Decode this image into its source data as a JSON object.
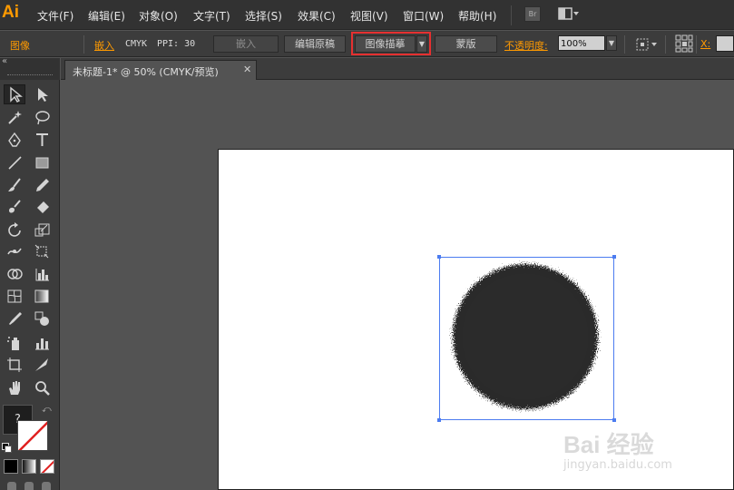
{
  "app": {
    "logo": "Ai"
  },
  "menu": {
    "items": [
      "文件(F)",
      "编辑(E)",
      "对象(O)",
      "文字(T)",
      "选择(S)",
      "效果(C)",
      "视图(V)",
      "窗口(W)",
      "帮助(H)"
    ],
    "bridge_label": "Br"
  },
  "control_bar": {
    "object_type": "图像",
    "embed_link": "嵌入",
    "color_mode": "CMYK",
    "ppi": "PPI: 30",
    "embed_button": "嵌入",
    "edit_original_button": "编辑原稿",
    "image_trace_button": "图像描摹",
    "mask_button": "蒙版",
    "opacity_label": "不透明度:",
    "opacity_value": "100%",
    "x_label": "X:"
  },
  "document": {
    "tab_title": "未标题-1* @ 50% (CMYK/预览)",
    "close_symbol": "✕"
  },
  "color_boxes": {
    "default_hint": "?"
  },
  "watermark": {
    "text": "Bai 经验",
    "url": "jingyan.baidu.com"
  },
  "colors": {
    "accent_orange": "#ff9a00",
    "highlight_red": "#e63030",
    "selection_blue": "#4c7cf0"
  }
}
